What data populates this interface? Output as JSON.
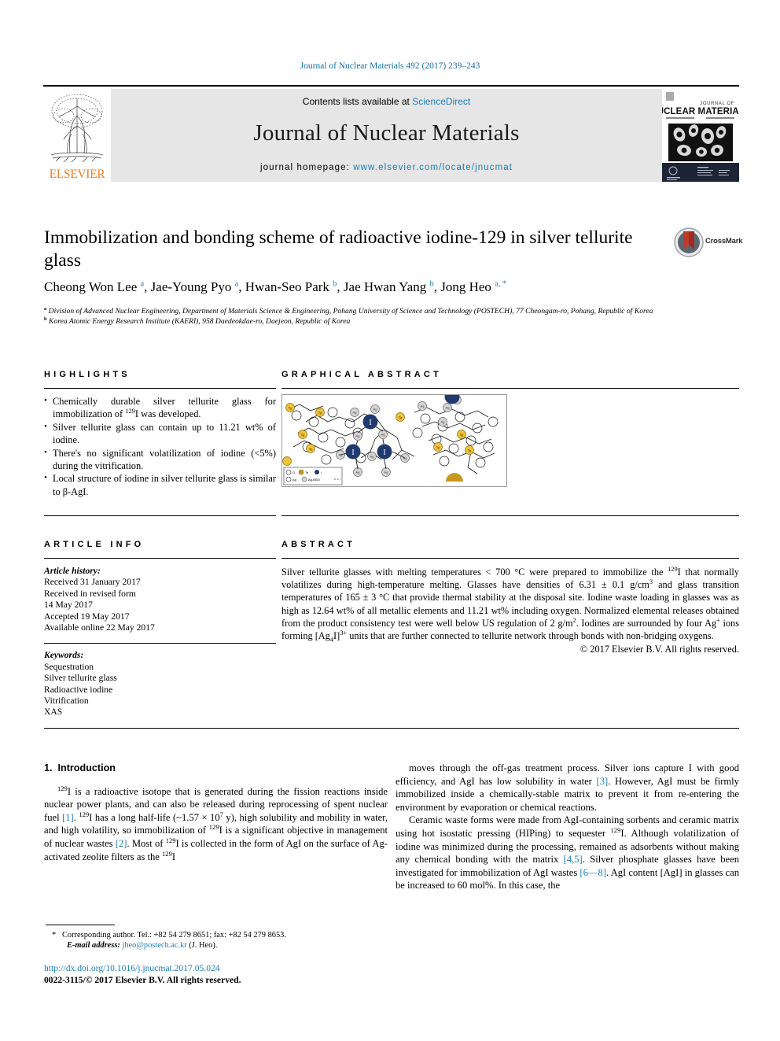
{
  "running_head": "Journal of Nuclear Materials 492 (2017) 239–243",
  "masthead": {
    "publisher": "ELSEVIER",
    "contents_prefix": "Contents lists available at ",
    "contents_link": "ScienceDirect",
    "journal_title": "Journal of Nuclear Materials",
    "homepage_prefix": "journal homepage: ",
    "homepage_url": "www.elsevier.com/locate/jnucmat",
    "cover_title_small": "JOURNAL OF",
    "cover_title_main": "NUCLEAR MATERIALS"
  },
  "article": {
    "title": "Immobilization and bonding scheme of radioactive iodine-129 in silver tellurite glass",
    "crossmark_label": "CrossMark",
    "authors_html": "Cheong Won Lee <sup>a</sup>, Jae-Young Pyo <sup>a</sup>, Hwan-Seo Park <sup>b</sup>, Jae Hwan Yang <sup>b</sup>, Jong Heo <sup>a, *</sup>",
    "affiliation_a": "Division of Advanced Nuclear Engineering, Department of Materials Science & Engineering, Pohang University of Science and Technology (POSTECH), 77 Cheongam-ro, Pohang, Republic of Korea",
    "affiliation_b": "Korea Atomic Energy Research Institute (KAERI), 958 Daedeokdae-ro, Daejeon, Republic of Korea"
  },
  "highlights": {
    "heading": "HIGHLIGHTS",
    "items_html": [
      "Chemically durable silver tellurite glass for immobilization of <sup>129</sup>I was developed.",
      "Silver tellurite glass can contain up to 11.21 wt% of iodine.",
      "There's no significant volatilization of iodine (<5%) during the vitrification.",
      "Local structure of iodine in silver tellurite glass is similar to β-AgI."
    ]
  },
  "graphical_abstract": {
    "heading": "GRAPHICAL ABSTRACT",
    "legend": [
      "O",
      "Te",
      "I",
      "Ag",
      "Ag-NBO"
    ],
    "atom_labels": [
      "I",
      "Ag",
      "Te"
    ],
    "colors": {
      "iodine": "#203a70",
      "tellurium": "#f0c23a",
      "silver": "#d2d2d2",
      "oxygen": "#ffffff",
      "bond": "#1a1a1a"
    }
  },
  "article_info": {
    "heading": "ARTICLE INFO",
    "history_label": "Article history:",
    "history": [
      "Received 31 January 2017",
      "Received in revised form",
      "14 May 2017",
      "Accepted 19 May 2017",
      "Available online 22 May 2017"
    ],
    "keywords_label": "Keywords:",
    "keywords": [
      "Sequestration",
      "Silver tellurite glass",
      "Radioactive iodine",
      "Vitrification",
      "XAS"
    ]
  },
  "abstract": {
    "heading": "ABSTRACT",
    "body_html": "Silver tellurite glasses with melting temperatures &lt; 700 °C were prepared to immobilize the <sup>129</sup>I that normally volatilizes during high-temperature melting. Glasses have densities of 6.31 ± 0.1 g/cm<sup>3</sup> and glass transition temperatures of 165 ± 3 °C that provide thermal stability at the disposal site. Iodine waste loading in glasses was as high as 12.64 wt% of all metallic elements and 11.21 wt% including oxygen. Normalized elemental releases obtained from the product consistency test were well below US regulation of 2 g/m<sup>2</sup>. Iodines are surrounded by four Ag<sup>+</sup> ions forming [Ag<sub>4</sub>I]<sup>3+</sup> units that are further connected to tellurite network through bonds with non-bridging oxygens.",
    "copyright": "© 2017 Elsevier B.V. All rights reserved."
  },
  "body": {
    "section_number": "1.",
    "section_title": "Introduction",
    "left_paragraph_html": "<sup>129</sup>I is a radioactive isotope that is generated during the fission reactions inside nuclear power plants, and can also be released during reprocessing of spent nuclear fuel <span class=\"ref\">[1]</span>. <sup>129</sup>I has a long half-life (~1.57 × 10<sup>7</sup> y), high solubility and mobility in water, and high volatility, so immobilization of <sup>129</sup>I is a significant objective in management of nuclear wastes <span class=\"ref\">[2]</span>. Most of <sup>129</sup>I is collected in the form of AgI on the surface of Ag-activated zeolite filters as the <sup>129</sup>I",
    "right_paragraph_1_html": "moves through the off-gas treatment process. Silver ions capture I with good efficiency, and AgI has low solubility in water <span class=\"ref\">[3]</span>. However, AgI must be firmly immobilized inside a chemically-stable matrix to prevent it from re-entering the environment by evaporation or chemical reactions.",
    "right_paragraph_2_html": "Ceramic waste forms were made from AgI-containing sorbents and ceramic matrix using hot isostatic pressing (HIPing) to sequester <sup>129</sup>I. Although volatilization of iodine was minimized during the processing, remained as adsorbents without making any chemical bonding with the matrix <span class=\"ref\">[4,5]</span>. Silver phosphate glasses have been investigated for immobilization of AgI wastes <span class=\"ref\">[6—8]</span>. AgI content [AgI] in glasses can be increased to 60 mol%. In this case, the"
  },
  "footnote": {
    "star": "*",
    "line1": "Corresponding author. Tel.: +82 54 279 8651; fax: +82 54 279 8653.",
    "email_label": "E-mail address:",
    "email": "jheo@postech.ac.kr",
    "email_owner": "(J. Heo)."
  },
  "footer": {
    "doi": "http://dx.doi.org/10.1016/j.jnucmat.2017.05.024",
    "issn_line": "0022-3115/© 2017 Elsevier B.V. All rights reserved."
  }
}
